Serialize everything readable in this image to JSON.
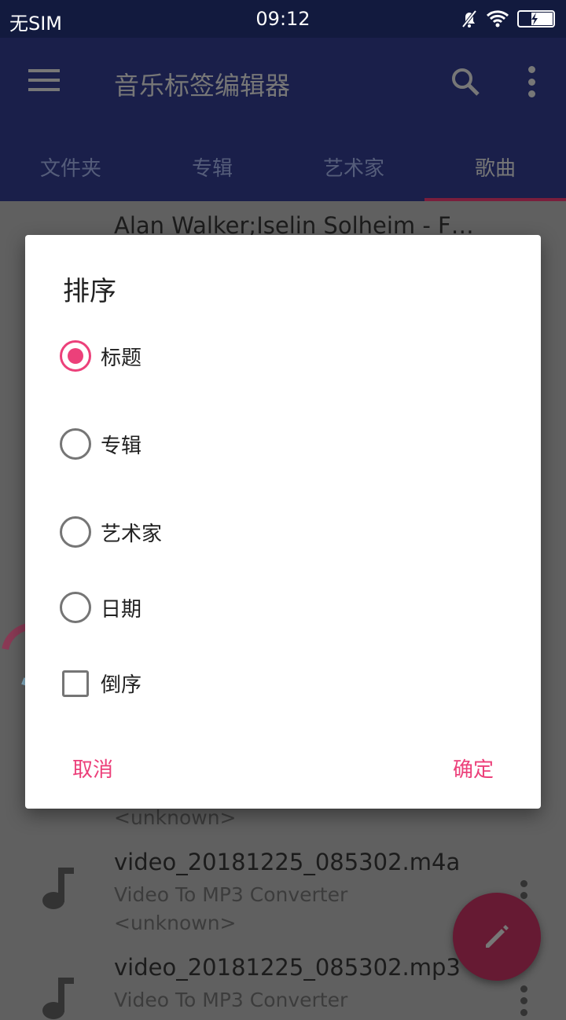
{
  "status": {
    "carrier": "无SIM",
    "time": "09:12"
  },
  "appbar": {
    "title": "音乐标签编辑器"
  },
  "tabs": [
    {
      "label": "文件夹"
    },
    {
      "label": "专辑"
    },
    {
      "label": "艺术家"
    },
    {
      "label": "歌曲",
      "active": true
    }
  ],
  "list": [
    {
      "title": "Alan Walker;Iselin Solheim - F…"
    },
    {
      "title": "",
      "subtitle": "",
      "extra": "<unknown>"
    },
    {
      "title": "video_20181225_085302.m4a",
      "subtitle": "Video To MP3 Converter",
      "extra": "<unknown>"
    },
    {
      "title": "video_20181225_085302.mp3",
      "subtitle": "Video To MP3 Converter"
    }
  ],
  "dialog": {
    "title": "排序",
    "options": [
      {
        "label": "标题",
        "selected": true
      },
      {
        "label": "专辑"
      },
      {
        "label": "艺术家"
      },
      {
        "label": "日期"
      }
    ],
    "reverse": {
      "label": "倒序",
      "checked": false
    },
    "cancel": "取消",
    "ok": "确定"
  },
  "colors": {
    "accent": "#ec407a",
    "primary": "#1a237e"
  }
}
